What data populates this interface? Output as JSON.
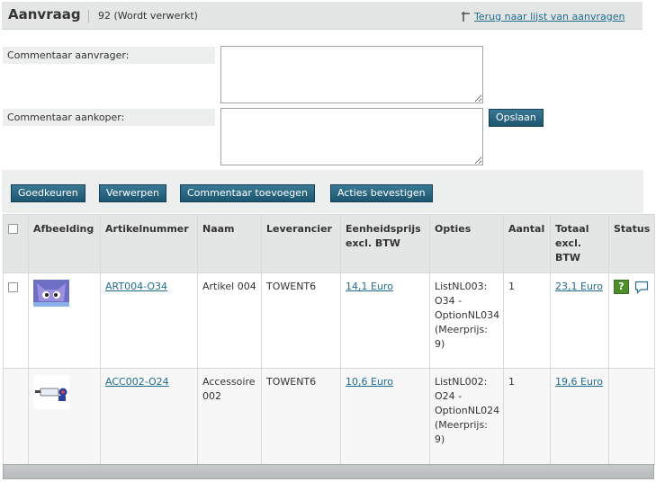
{
  "header": {
    "title": "Aanvraag",
    "status": "92 (Wordt verwerkt)",
    "back_link": "Terug naar lijst van aanvragen"
  },
  "comments": {
    "requester_label": "Commentaar aanvrager:",
    "requester_value": "",
    "buyer_label": "Commentaar aankoper:",
    "buyer_value": "",
    "save_button": "Opslaan"
  },
  "actions": {
    "approve": "Goedkeuren",
    "reject": "Verwerpen",
    "add_comment": "Commentaar toevoegen",
    "confirm": "Acties bevestigen"
  },
  "table": {
    "headers": {
      "image": "Afbeelding",
      "article_number": "Artikelnummer",
      "name": "Naam",
      "supplier": "Leverancier",
      "unit_price": "Eenheidsprijs excl. BTW",
      "options": "Opties",
      "quantity": "Aantal",
      "total": "Totaal excl. BTW",
      "status": "Status"
    },
    "rows": [
      {
        "article_number": "ART004-O34",
        "name": "Artikel 004",
        "supplier": "TOWENT6",
        "unit_price": "14,1 Euro",
        "options": "ListNL003: O34 - OptionNL034 (Meerprijs: 9)",
        "quantity": "1",
        "total": "23,1 Euro",
        "status_badge": "?",
        "image_icon": "purple-monster-icon"
      },
      {
        "article_number": "ACC002-O24",
        "name": "Accessoire 002",
        "supplier": "TOWENT6",
        "unit_price": "10,6 Euro",
        "options": "ListNL002: O24 - OptionNL024 (Meerprijs: 9)",
        "quantity": "1",
        "total": "19,6 Euro",
        "image_icon": "usb-drive-icon"
      }
    ]
  }
}
